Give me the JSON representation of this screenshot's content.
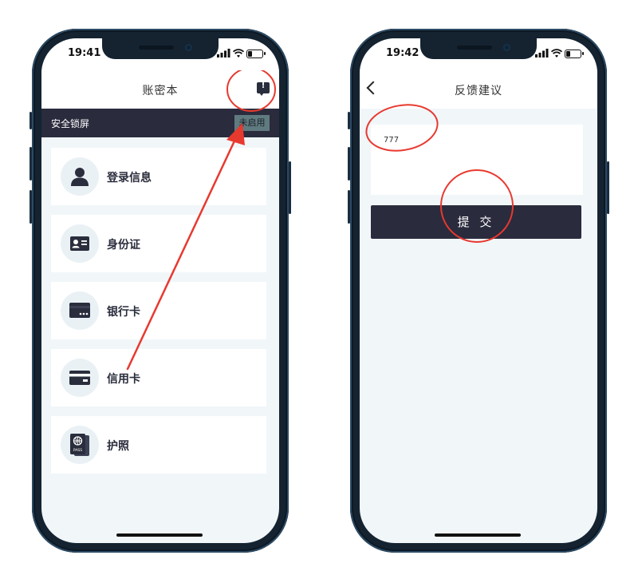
{
  "left_screen": {
    "time": "19:41",
    "title": "账密本",
    "feedback_icon": "feedback-icon",
    "lock_bar": {
      "label": "安全锁屏",
      "status": "未启用"
    },
    "items": [
      {
        "label": "登录信息",
        "icon": "person-icon"
      },
      {
        "label": "身份证",
        "icon": "id-card-icon"
      },
      {
        "label": "银行卡",
        "icon": "bank-card-icon"
      },
      {
        "label": "信用卡",
        "icon": "credit-card-icon"
      },
      {
        "label": "护照",
        "icon": "passport-icon"
      }
    ]
  },
  "right_screen": {
    "time": "19:42",
    "title": "反馈建议",
    "back_icon": "back-chevron-icon",
    "feedback_value": "777",
    "submit_label": "提 交"
  },
  "annotation_color": "#e8392f"
}
